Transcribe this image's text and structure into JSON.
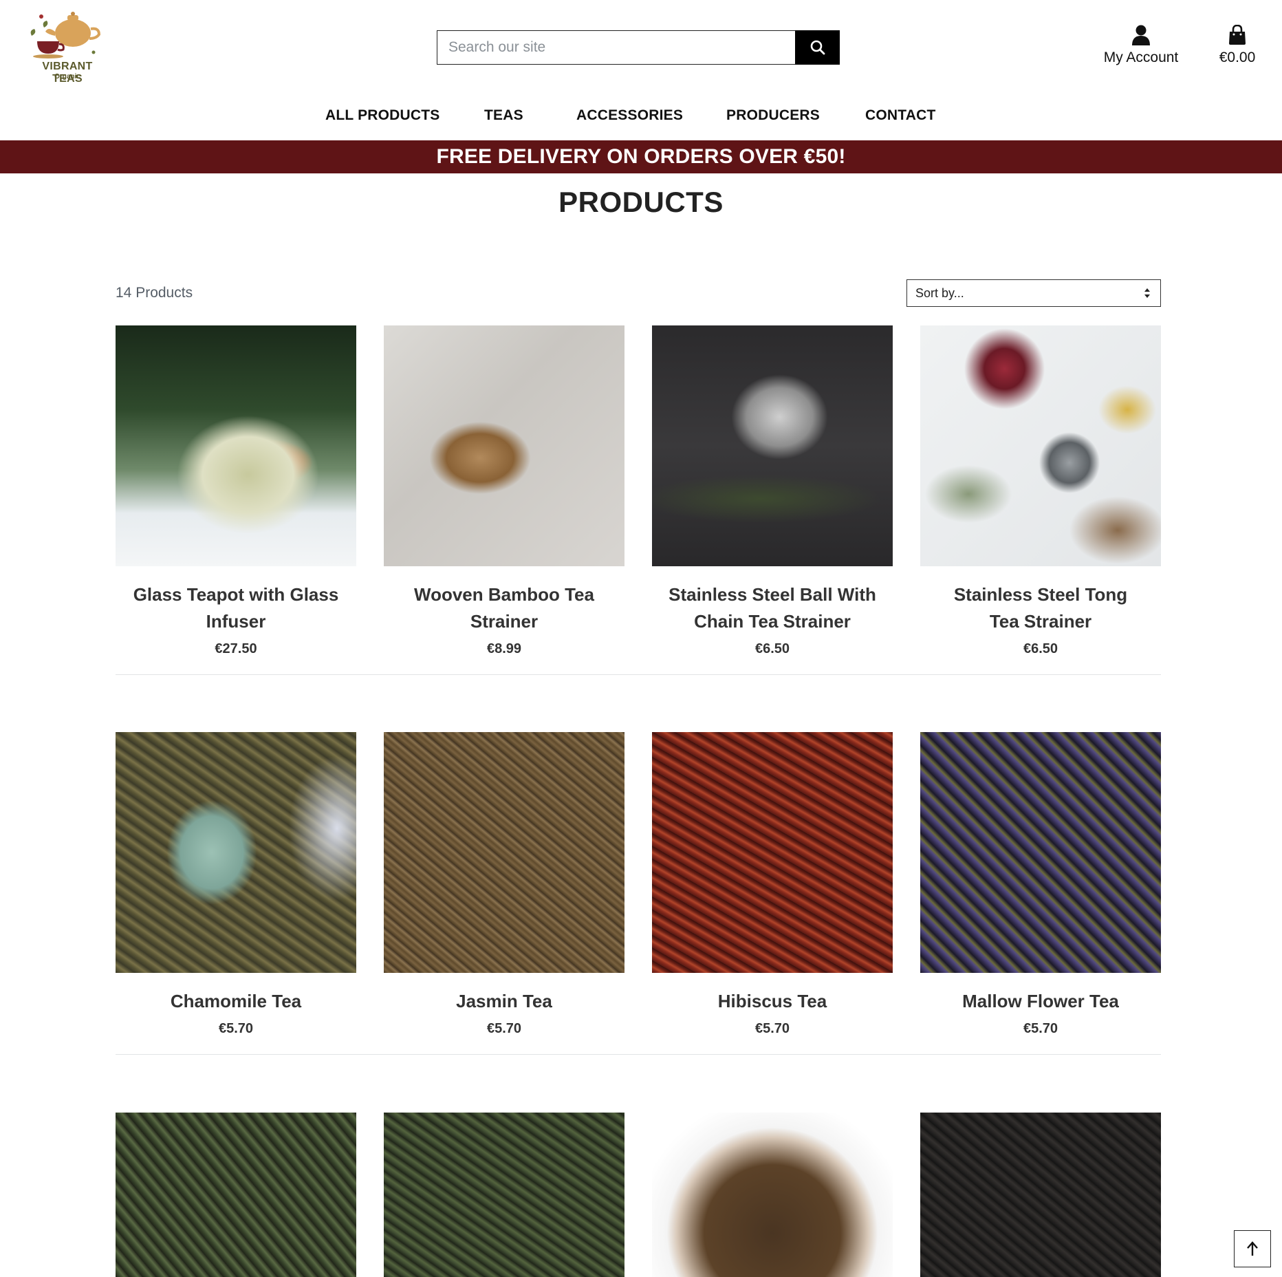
{
  "header": {
    "logo_text": "VIBRANT TEAS",
    "logo_sub": "Organic",
    "search_placeholder": "Search our site",
    "account_label": "My Account",
    "cart_total": "€0.00"
  },
  "nav": {
    "items": [
      "ALL PRODUCTS",
      "TEAS",
      "ACCESSORIES",
      "PRODUCERS",
      "CONTACT"
    ]
  },
  "banner": {
    "text": "FREE DELIVERY ON ORDERS OVER €50!"
  },
  "main": {
    "title": "PRODUCTS",
    "product_count": "14 Products",
    "sort_label": "Sort by..."
  },
  "products": [
    {
      "name": "Glass Teapot with Glass Infuser",
      "price": "€27.50"
    },
    {
      "name": "Wooven Bamboo Tea Strainer",
      "price": "€8.99"
    },
    {
      "name": "Stainless Steel Ball With Chain Tea Strainer",
      "price": "€6.50"
    },
    {
      "name": "Stainless Steel Tong Tea Strainer",
      "price": "€6.50"
    },
    {
      "name": "Chamomile Tea",
      "price": "€5.70"
    },
    {
      "name": "Jasmin Tea",
      "price": "€5.70"
    },
    {
      "name": "Hibiscus Tea",
      "price": "€5.70"
    },
    {
      "name": "Mallow Flower Tea",
      "price": "€5.70"
    }
  ],
  "colors": {
    "banner": "#5f1416",
    "search_button": "#000000",
    "text": "#212529"
  },
  "icons": {
    "search": "search-icon",
    "account": "user-icon",
    "cart": "shopping-bag-icon",
    "back_to_top": "arrow-up-icon",
    "sort": "sort-arrows-icon"
  }
}
